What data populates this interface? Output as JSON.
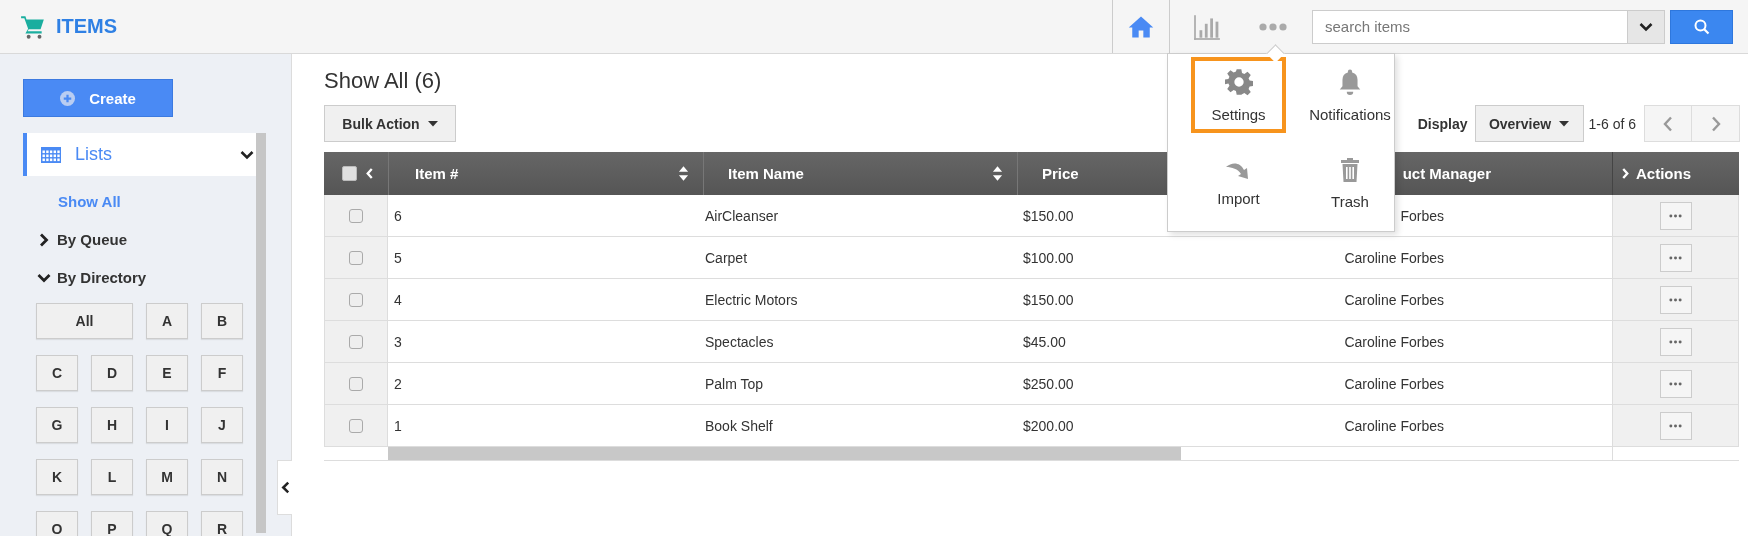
{
  "app": {
    "title": "ITEMS"
  },
  "nav": [
    {
      "kind": "home",
      "selected": true
    },
    {
      "kind": "chart",
      "selected": false
    },
    {
      "kind": "more",
      "selected": false
    }
  ],
  "search": {
    "placeholder": "search items"
  },
  "sidebar": {
    "create": "Create",
    "lists": {
      "label": "Lists",
      "expanded": true
    },
    "items": [
      {
        "label": "Show All",
        "kind": "link",
        "selected": true
      },
      {
        "label": "By Queue",
        "kind": "group",
        "expanded": false
      },
      {
        "label": "By Directory",
        "kind": "group",
        "expanded": true
      }
    ],
    "directory": [
      "All",
      "A",
      "B",
      "C",
      "D",
      "E",
      "F",
      "G",
      "H",
      "I",
      "J",
      "K",
      "L",
      "M",
      "N",
      "O",
      "P",
      "Q",
      "R"
    ]
  },
  "main": {
    "title": "Show All (6)",
    "bulk_action": "Bulk Action",
    "display_label": "Display",
    "display_value": "Overview",
    "range": "1-6 of 6"
  },
  "table": {
    "header_checked": false,
    "columns": [
      {
        "label": "Item #",
        "kind": "sort"
      },
      {
        "label": "Item Name",
        "kind": "sort"
      },
      {
        "label": "Price",
        "kind": "plain"
      },
      {
        "label": "uct Manager",
        "kind": "plain"
      },
      {
        "label": "Actions",
        "kind": "expand"
      }
    ],
    "rows": [
      {
        "checked": false,
        "item": "6",
        "name": "AirCleanser",
        "price": "$150.00",
        "manager": "Forbes"
      },
      {
        "checked": false,
        "item": "5",
        "name": "Carpet",
        "price": "$100.00",
        "manager": "Caroline Forbes"
      },
      {
        "checked": false,
        "item": "4",
        "name": "Electric Motors",
        "price": "$150.00",
        "manager": "Caroline Forbes"
      },
      {
        "checked": false,
        "item": "3",
        "name": "Spectacles",
        "price": "$45.00",
        "manager": "Caroline Forbes"
      },
      {
        "checked": false,
        "item": "2",
        "name": "Palm Top",
        "price": "$250.00",
        "manager": "Caroline Forbes"
      },
      {
        "checked": false,
        "item": "1",
        "name": "Book Shelf",
        "price": "$200.00",
        "manager": "Caroline Forbes"
      }
    ]
  },
  "menu": {
    "items": [
      {
        "label": "Settings",
        "kind": "settings",
        "selected": true
      },
      {
        "label": "Notifications",
        "kind": "notifications",
        "selected": false
      },
      {
        "label": "Import",
        "kind": "import",
        "selected": false
      },
      {
        "label": "Trash",
        "kind": "trash",
        "selected": false
      }
    ]
  }
}
